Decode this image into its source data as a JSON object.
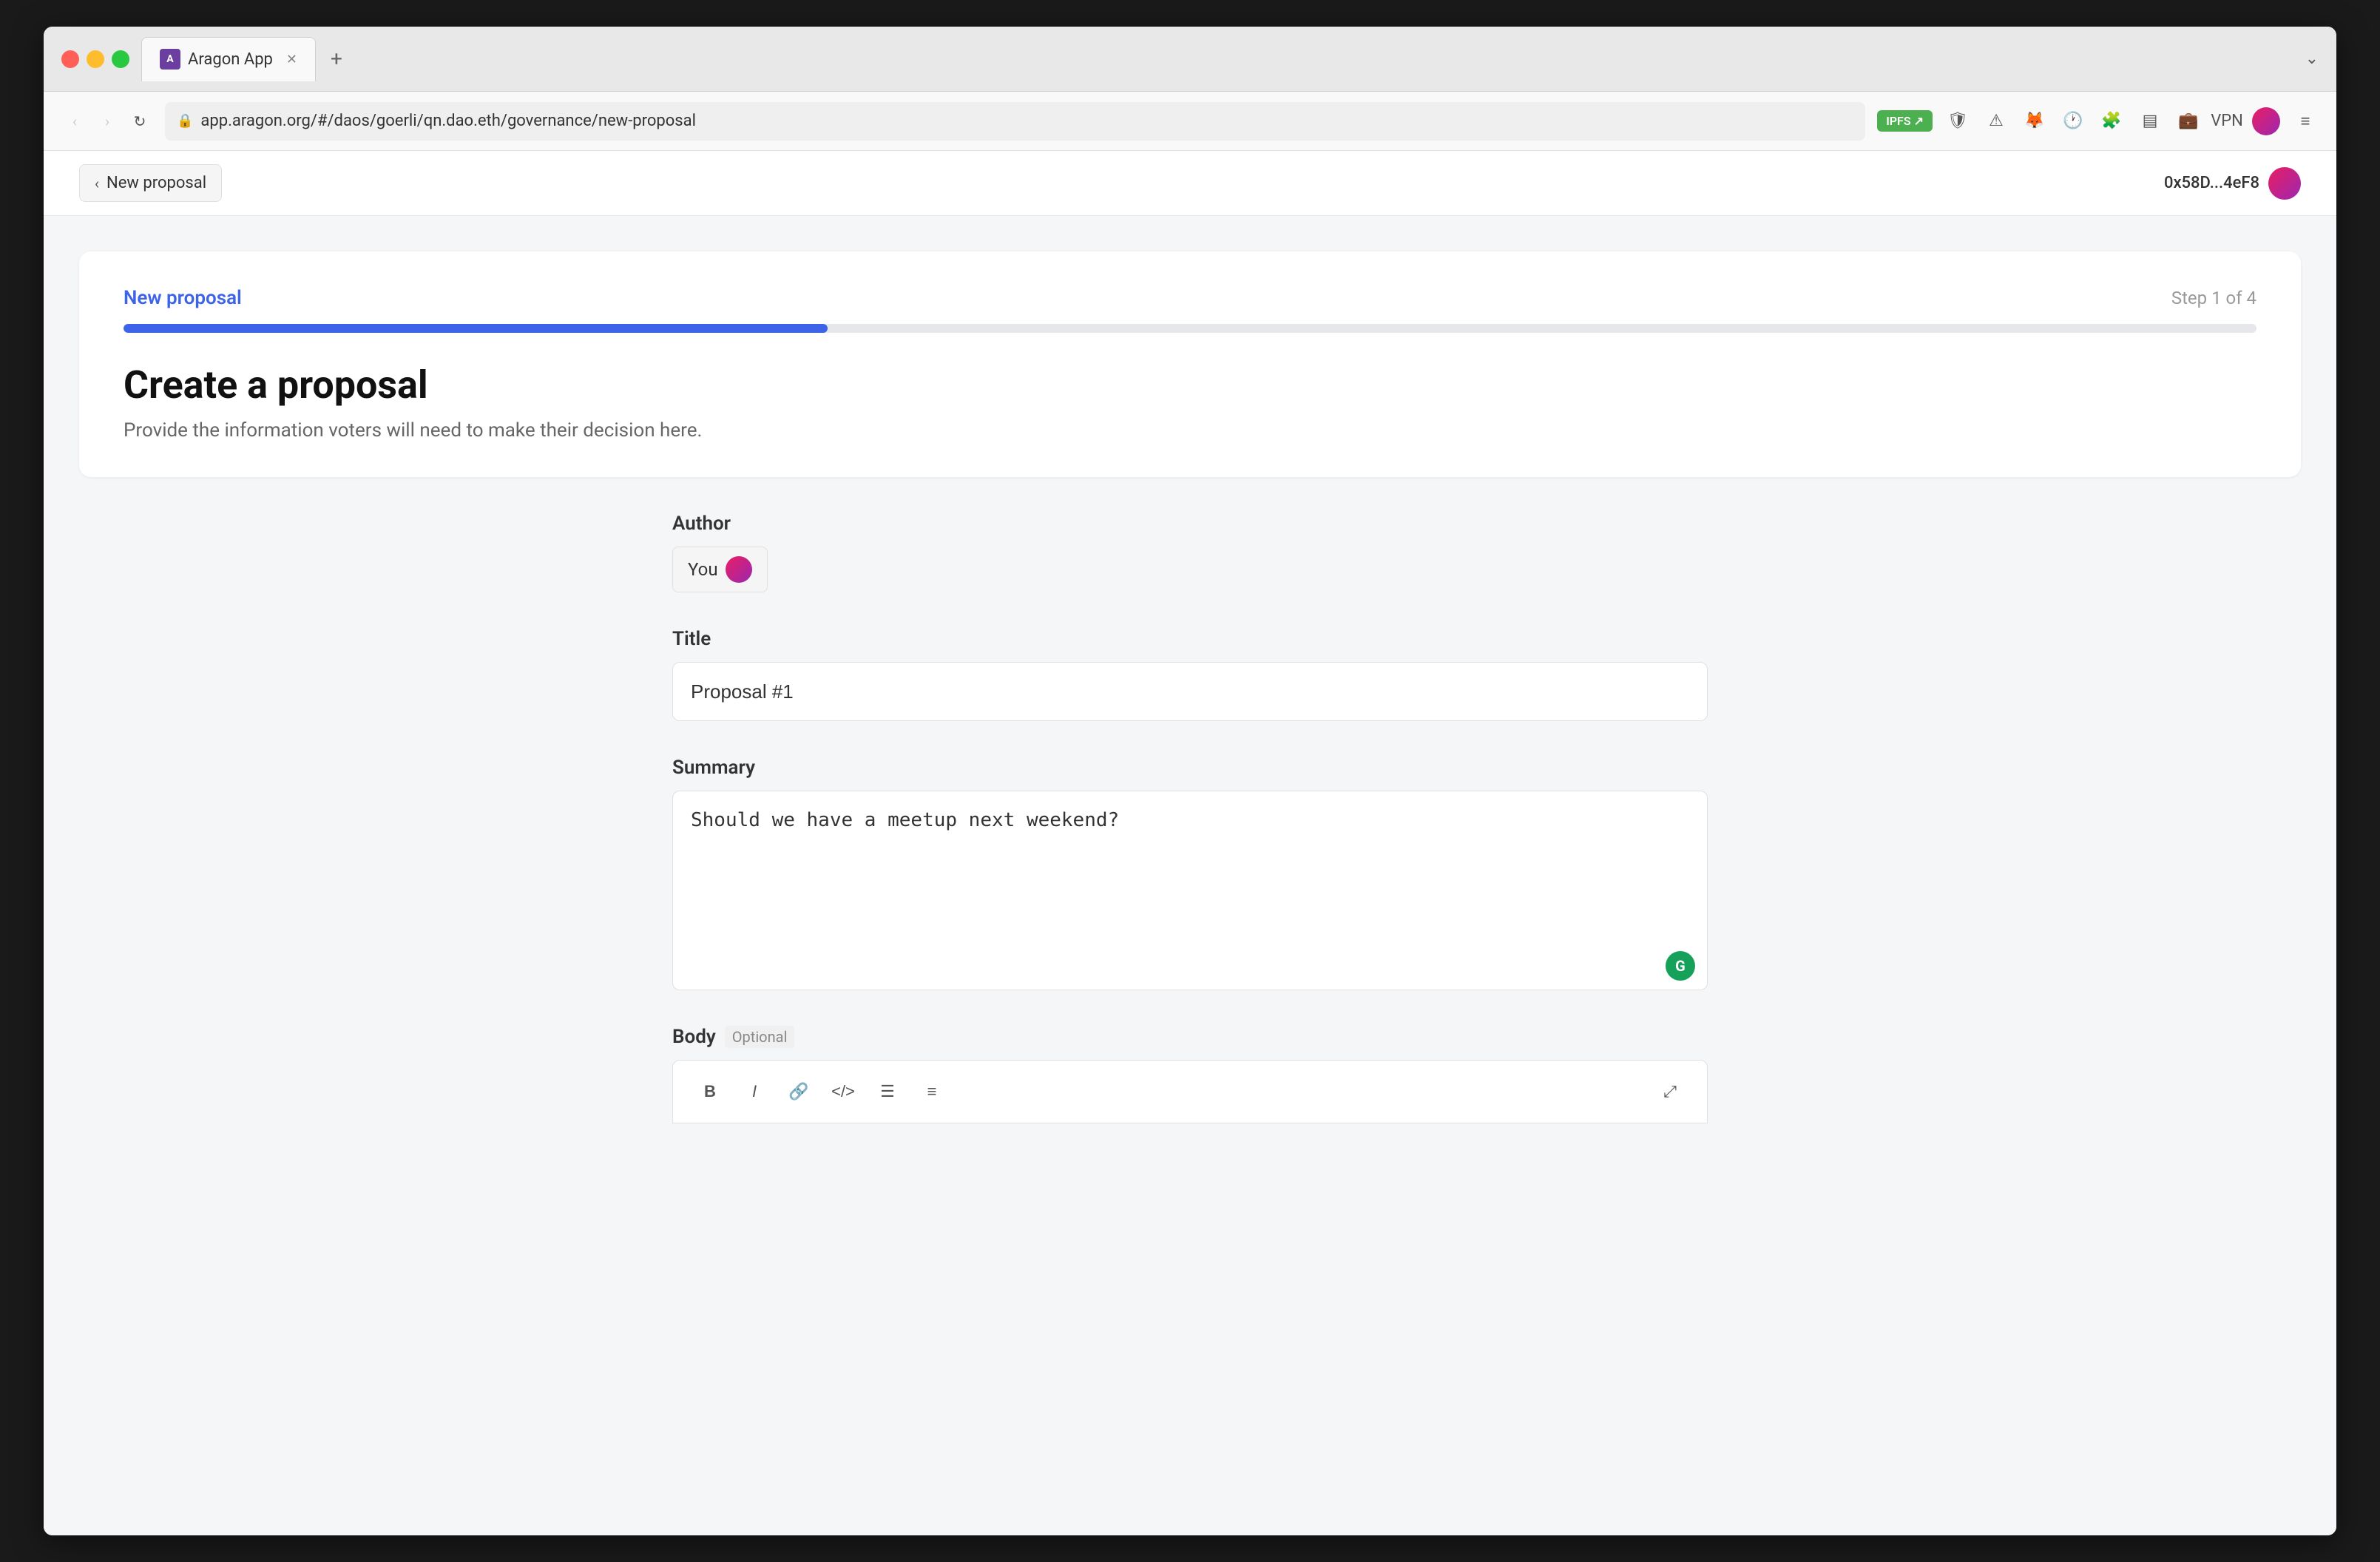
{
  "browser": {
    "tab_title": "Aragon App",
    "url": "app.aragon.org/#/daos/goerli/qn.dao.eth/governance/new-proposal",
    "wallet_display": "0x58D...4eF8"
  },
  "page_header": {
    "back_label": "New proposal",
    "wallet_address": "0x58D...4eF8"
  },
  "progress": {
    "title": "New proposal",
    "step_label": "Step 1 of 4",
    "fill_percent": "33%"
  },
  "form": {
    "main_heading": "Create a proposal",
    "main_subheading": "Provide the information voters will need to make their decision here.",
    "author_label": "Author",
    "author_name": "You",
    "title_label": "Title",
    "title_value": "Proposal #1",
    "title_placeholder": "Proposal #1",
    "summary_label": "Summary",
    "summary_value": "Should we have a meetup next weekend?",
    "summary_placeholder": "Should we have a meetup next weekend?",
    "body_label": "Body",
    "body_optional": "Optional"
  },
  "toolbar": {
    "bold": "B",
    "italic": "I",
    "link": "🔗",
    "code": "</>",
    "ordered_list": "ol",
    "unordered_list": "ul",
    "expand": "⤢"
  }
}
